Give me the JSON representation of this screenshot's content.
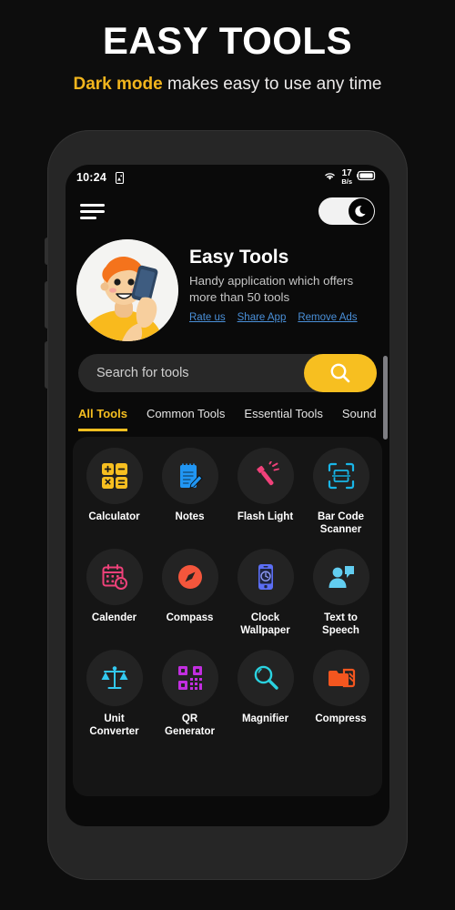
{
  "promo": {
    "title": "EASY TOOLS",
    "subtitle_highlight": "Dark mode",
    "subtitle_rest": " makes easy to use any time"
  },
  "status_bar": {
    "time": "10:24",
    "left_icon": "image-download-icon",
    "wifi_icon": "wifi-icon",
    "net_speed_value": "17",
    "net_speed_unit": "B/s",
    "battery_icon": "battery-icon"
  },
  "top_bar": {
    "menu_icon": "hamburger-menu-icon",
    "dark_mode_toggle": "dark-mode-toggle",
    "dark_mode_icon": "moon-icon",
    "dark_mode_on": true
  },
  "app_header": {
    "avatar": "man-with-phone-avatar",
    "title": "Easy Tools",
    "description": "Handy application which offers more than 50 tools",
    "links": [
      {
        "label": "Rate us",
        "name": "rate-us-link"
      },
      {
        "label": "Share App",
        "name": "share-app-link"
      },
      {
        "label": "Remove Ads",
        "name": "remove-ads-link"
      }
    ]
  },
  "search": {
    "placeholder": "Search for tools",
    "value": "",
    "button_icon": "search-icon"
  },
  "tabs": [
    {
      "label": "All Tools",
      "active": true
    },
    {
      "label": "Common Tools",
      "active": false
    },
    {
      "label": "Essential Tools",
      "active": false
    },
    {
      "label": "Sound",
      "active": false
    }
  ],
  "tools": [
    [
      {
        "label": "Calculator",
        "icon": "calculator-icon",
        "color": "#f7bf20"
      },
      {
        "label": "Notes",
        "icon": "notes-icon",
        "color": "#2196f3"
      },
      {
        "label": "Flash Light",
        "icon": "flashlight-icon",
        "color": "#f0417a"
      },
      {
        "label": "Bar Code Scanner",
        "icon": "barcode-scanner-icon",
        "color": "#19b6e8"
      }
    ],
    [
      {
        "label": "Calender",
        "icon": "calendar-icon",
        "color": "#f0417a"
      },
      {
        "label": "Compass",
        "icon": "compass-icon",
        "color": "#f4563c"
      },
      {
        "label": "Clock Wallpaper",
        "icon": "clock-wallpaper-icon",
        "color": "#5b6ef5"
      },
      {
        "label": "Text to Speech",
        "icon": "text-to-speech-icon",
        "color": "#62cdf0"
      }
    ],
    [
      {
        "label": "Unit Converter",
        "icon": "scales-icon",
        "color": "#33c9f0"
      },
      {
        "label": "QR Generator",
        "icon": "qr-code-icon",
        "color": "#c22ee0"
      },
      {
        "label": "Magnifier",
        "icon": "magnifier-icon",
        "color": "#2ad2e0"
      },
      {
        "label": "Compress",
        "icon": "compress-folder-icon",
        "color": "#f4561f"
      }
    ]
  ],
  "colors": {
    "accent": "#f7bf20",
    "background": "#0d0d0d",
    "screen": "#0a0a0a",
    "link": "#4a90d9"
  }
}
